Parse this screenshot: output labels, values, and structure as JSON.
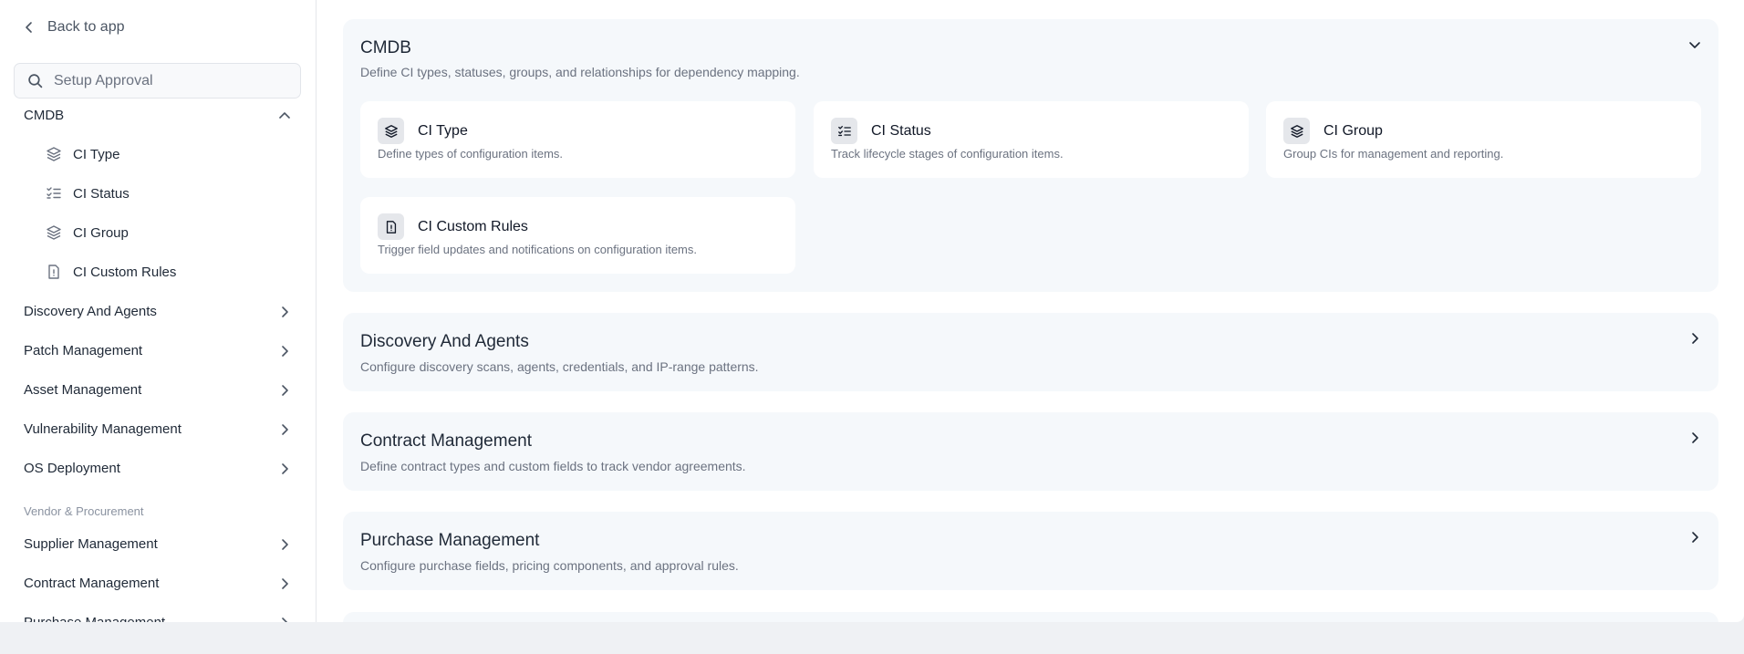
{
  "sidebar": {
    "back_label": "Back to app",
    "search_placeholder": "Setup Approval",
    "cmdb_label": "CMDB",
    "cmdb_items": [
      {
        "label": "CI Type",
        "icon": "layers-icon"
      },
      {
        "label": "CI Status",
        "icon": "checklist-icon"
      },
      {
        "label": "CI Group",
        "icon": "layers-icon"
      },
      {
        "label": "CI Custom Rules",
        "icon": "file-alert-icon"
      }
    ],
    "groups": [
      "Discovery And Agents",
      "Patch Management",
      "Asset Management",
      "Vulnerability Management",
      "OS Deployment"
    ],
    "section_vendor": "Vendor & Procurement",
    "vendor_groups": [
      "Supplier Management",
      "Contract Management",
      "Purchase Management"
    ]
  },
  "main": {
    "cmdb": {
      "title": "CMDB",
      "desc": "Define CI types, statuses, groups, and relationships for dependency mapping.",
      "cards": [
        {
          "title": "CI Type",
          "desc": "Define types of configuration items.",
          "icon": "layers-icon"
        },
        {
          "title": "CI Status",
          "desc": "Track lifecycle stages of configuration items.",
          "icon": "checklist-icon"
        },
        {
          "title": "CI Group",
          "desc": "Group CIs for management and reporting.",
          "icon": "layers-icon"
        },
        {
          "title": "CI Custom Rules",
          "desc": "Trigger field updates and notifications on configuration items.",
          "icon": "file-alert-icon"
        }
      ]
    },
    "discovery": {
      "title": "Discovery And Agents",
      "desc": "Configure discovery scans, agents, credentials, and IP-range patterns."
    },
    "contract": {
      "title": "Contract Management",
      "desc": "Define contract types and custom fields to track vendor agreements."
    },
    "purchase": {
      "title": "Purchase Management",
      "desc": "Configure purchase fields, pricing components, and approval rules."
    }
  },
  "colors": {
    "panel_bg": "#f5f8fb",
    "card_bg": "#ffffff",
    "icon_bg": "#e5e7eb",
    "text_primary": "#1f2937",
    "text_muted": "#6b7280",
    "section_label": "#8b93a1"
  }
}
